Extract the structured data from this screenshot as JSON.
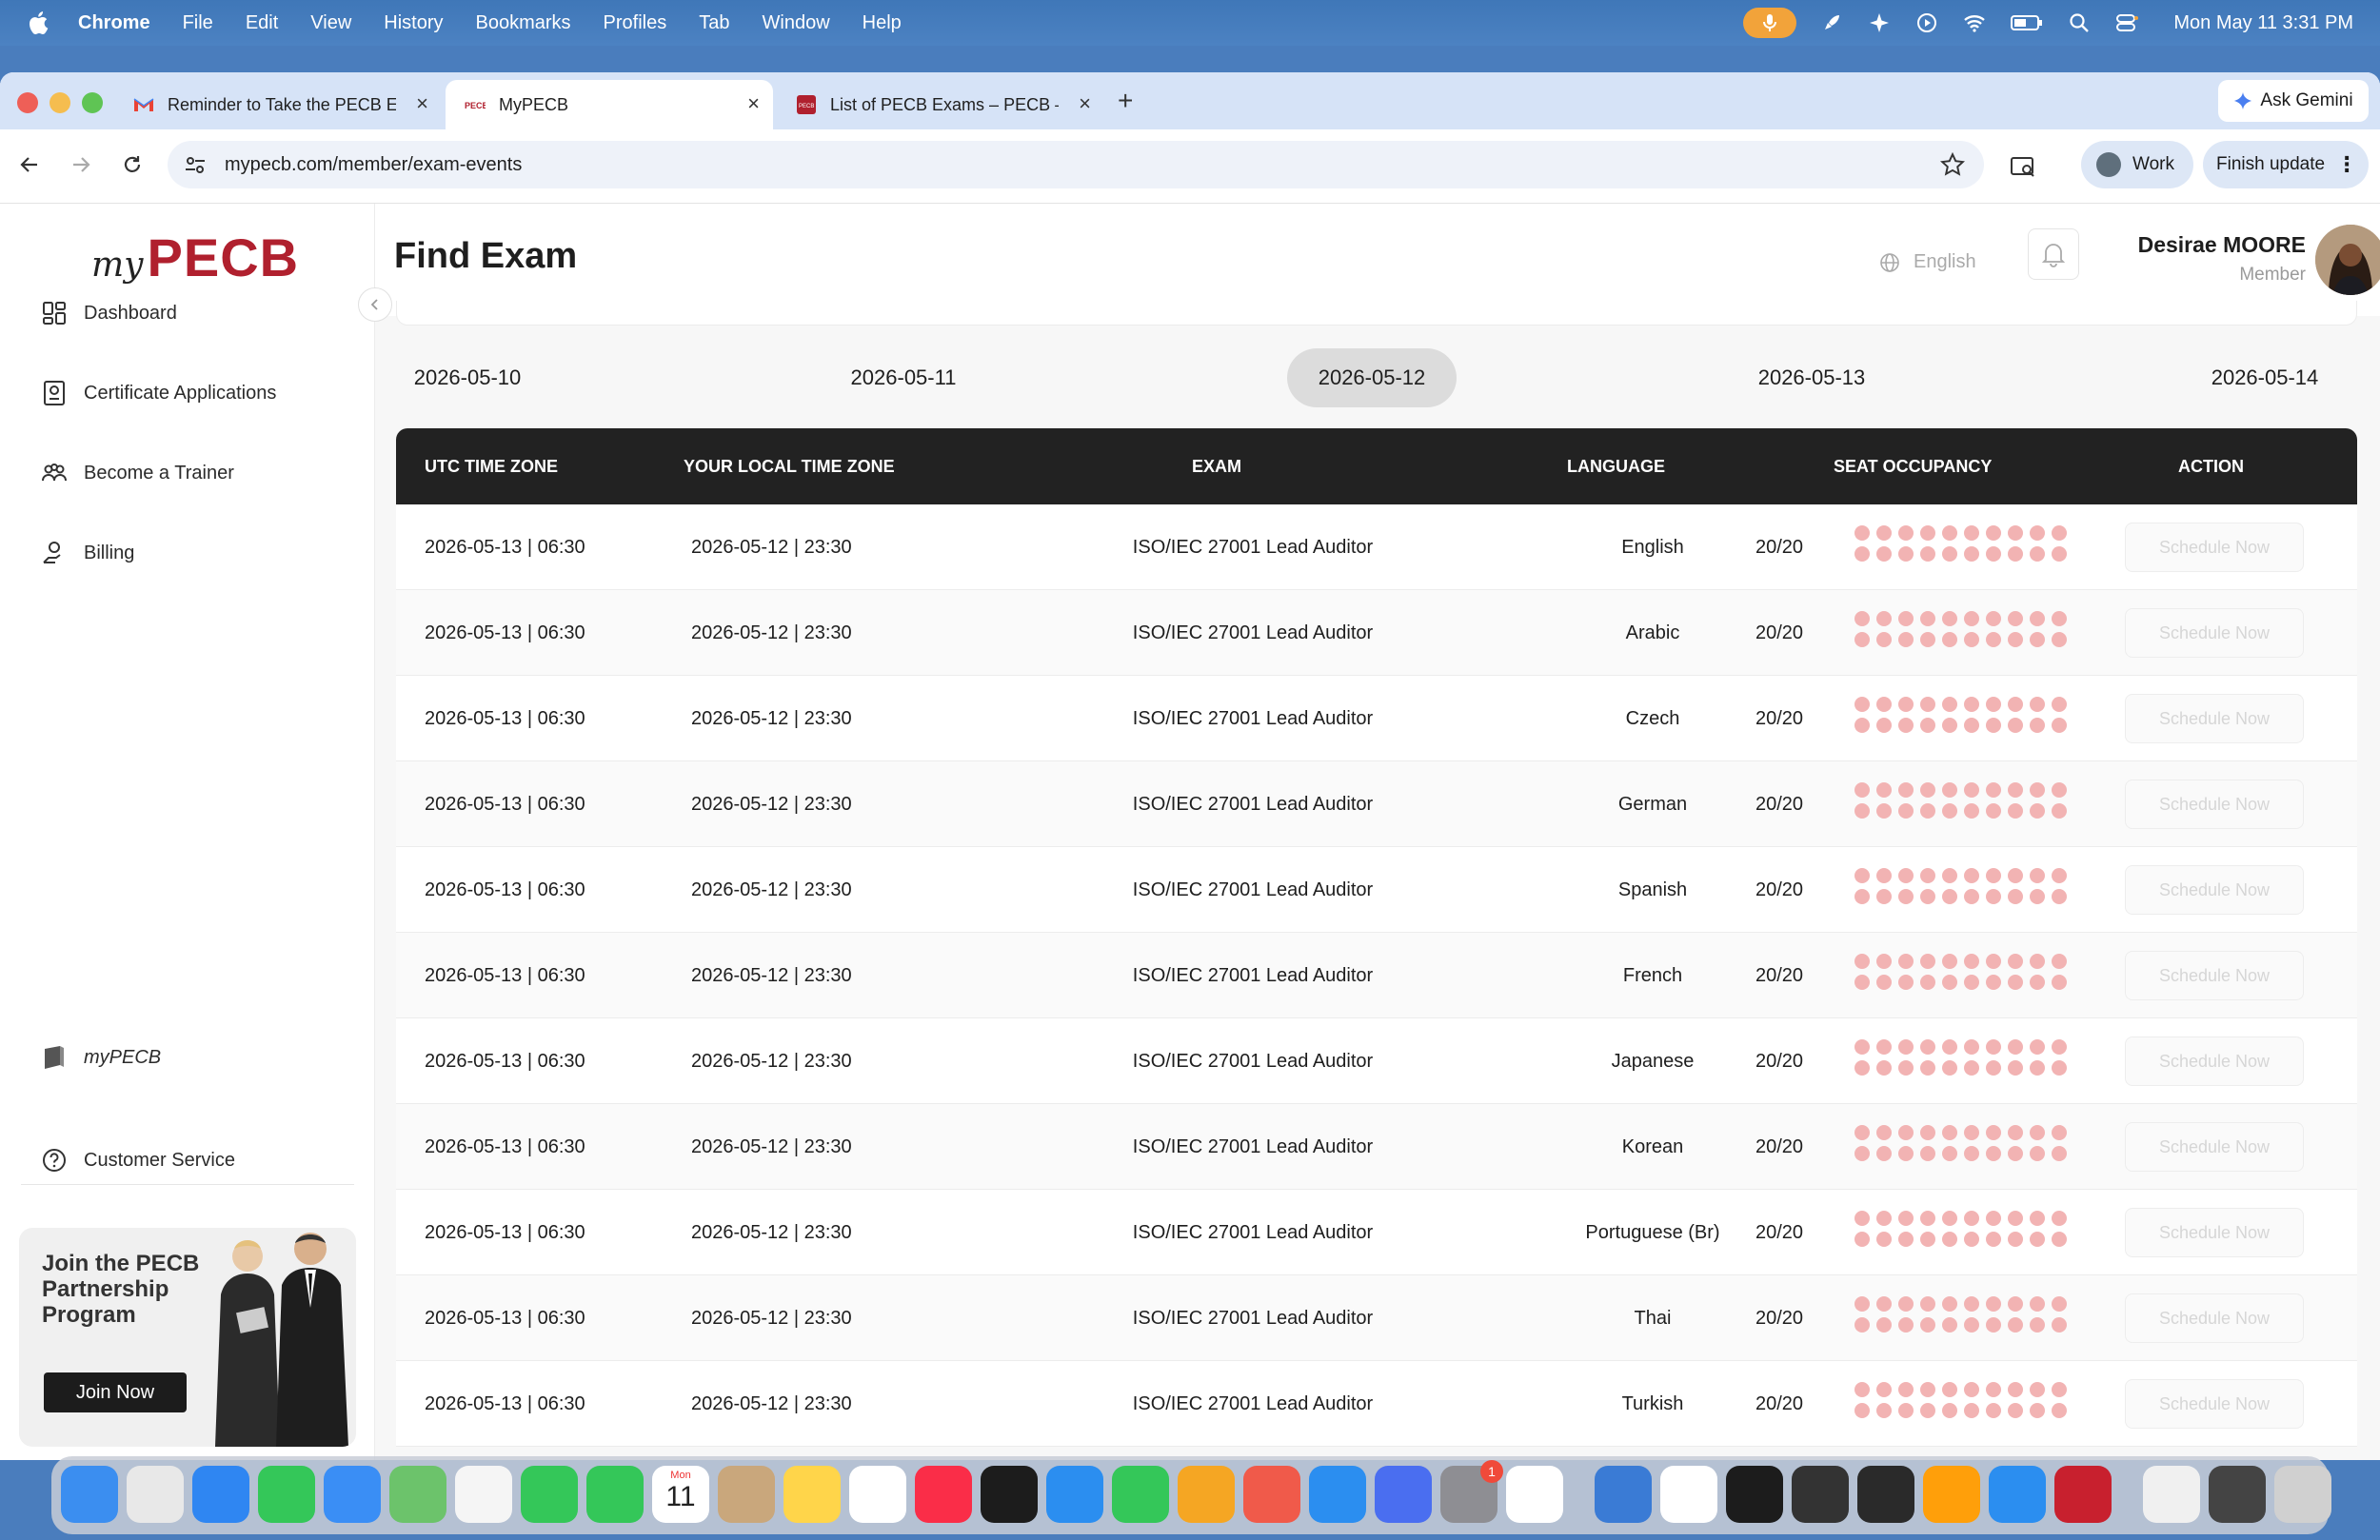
{
  "menubar": {
    "app": "Chrome",
    "items": [
      "File",
      "Edit",
      "View",
      "History",
      "Bookmarks",
      "Profiles",
      "Tab",
      "Window",
      "Help"
    ],
    "clock": "Mon May 11  3:31 PM"
  },
  "tabs": [
    {
      "title": "Reminder to Take the PECB E",
      "icon": "gmail-icon"
    },
    {
      "title": "MyPECB",
      "icon": "pecb-favicon"
    },
    {
      "title": "List of PECB Exams – PECB –",
      "icon": "pecb-favicon"
    }
  ],
  "toolbar": {
    "url": "mypecb.com/member/exam-events",
    "ask_gemini": "Ask Gemini",
    "work": "Work",
    "finish_update": "Finish update"
  },
  "sidebar": {
    "logo_my": "my",
    "logo_pecb": "PECB",
    "items": [
      {
        "label": "Dashboard",
        "icon": "dashboard-icon"
      },
      {
        "label": "Certificate Applications",
        "icon": "certificate-icon"
      },
      {
        "label": "Become a Trainer",
        "icon": "trainer-icon"
      },
      {
        "label": "Billing",
        "icon": "billing-icon"
      }
    ],
    "mypecb_label": "myPECB",
    "customer_service": "Customer Service",
    "promo_title": "Join the PECB Partnership Program",
    "promo_button": "Join Now"
  },
  "header": {
    "title": "Find Exam",
    "language": "English",
    "user_name": "Desirae MOORE",
    "user_role": "Member"
  },
  "dates": [
    "2026-05-10",
    "2026-05-11",
    "2026-05-12",
    "2026-05-13",
    "2026-05-14"
  ],
  "selected_date_index": 2,
  "table": {
    "columns": [
      "UTC TIME ZONE",
      "YOUR LOCAL TIME ZONE",
      "EXAM",
      "LANGUAGE",
      "SEAT OCCUPANCY",
      "ACTION"
    ],
    "action_label": "Schedule Now",
    "rows": [
      {
        "utc": "2026-05-13 | 06:30",
        "local": "2026-05-12 | 23:30",
        "exam": "ISO/IEC 27001 Lead Auditor",
        "language": "English",
        "occupancy": "20/20"
      },
      {
        "utc": "2026-05-13 | 06:30",
        "local": "2026-05-12 | 23:30",
        "exam": "ISO/IEC 27001 Lead Auditor",
        "language": "Arabic",
        "occupancy": "20/20"
      },
      {
        "utc": "2026-05-13 | 06:30",
        "local": "2026-05-12 | 23:30",
        "exam": "ISO/IEC 27001 Lead Auditor",
        "language": "Czech",
        "occupancy": "20/20"
      },
      {
        "utc": "2026-05-13 | 06:30",
        "local": "2026-05-12 | 23:30",
        "exam": "ISO/IEC 27001 Lead Auditor",
        "language": "German",
        "occupancy": "20/20"
      },
      {
        "utc": "2026-05-13 | 06:30",
        "local": "2026-05-12 | 23:30",
        "exam": "ISO/IEC 27001 Lead Auditor",
        "language": "Spanish",
        "occupancy": "20/20"
      },
      {
        "utc": "2026-05-13 | 06:30",
        "local": "2026-05-12 | 23:30",
        "exam": "ISO/IEC 27001 Lead Auditor",
        "language": "French",
        "occupancy": "20/20"
      },
      {
        "utc": "2026-05-13 | 06:30",
        "local": "2026-05-12 | 23:30",
        "exam": "ISO/IEC 27001 Lead Auditor",
        "language": "Japanese",
        "occupancy": "20/20"
      },
      {
        "utc": "2026-05-13 | 06:30",
        "local": "2026-05-12 | 23:30",
        "exam": "ISO/IEC 27001 Lead Auditor",
        "language": "Korean",
        "occupancy": "20/20"
      },
      {
        "utc": "2026-05-13 | 06:30",
        "local": "2026-05-12 | 23:30",
        "exam": "ISO/IEC 27001 Lead Auditor",
        "language": "Portuguese (Br)",
        "occupancy": "20/20"
      },
      {
        "utc": "2026-05-13 | 06:30",
        "local": "2026-05-12 | 23:30",
        "exam": "ISO/IEC 27001 Lead Auditor",
        "language": "Thai",
        "occupancy": "20/20"
      },
      {
        "utc": "2026-05-13 | 06:30",
        "local": "2026-05-12 | 23:30",
        "exam": "ISO/IEC 27001 Lead Auditor",
        "language": "Turkish",
        "occupancy": "20/20"
      }
    ]
  },
  "colors": {
    "brand_red": "#b0202e",
    "table_header": "#222222",
    "seat_dot": "#f2b3b3",
    "selected_date_bg": "#dcdcdc"
  },
  "dock": {
    "calendar_month": "Mon",
    "calendar_day": "11",
    "settings_badge": "1"
  }
}
